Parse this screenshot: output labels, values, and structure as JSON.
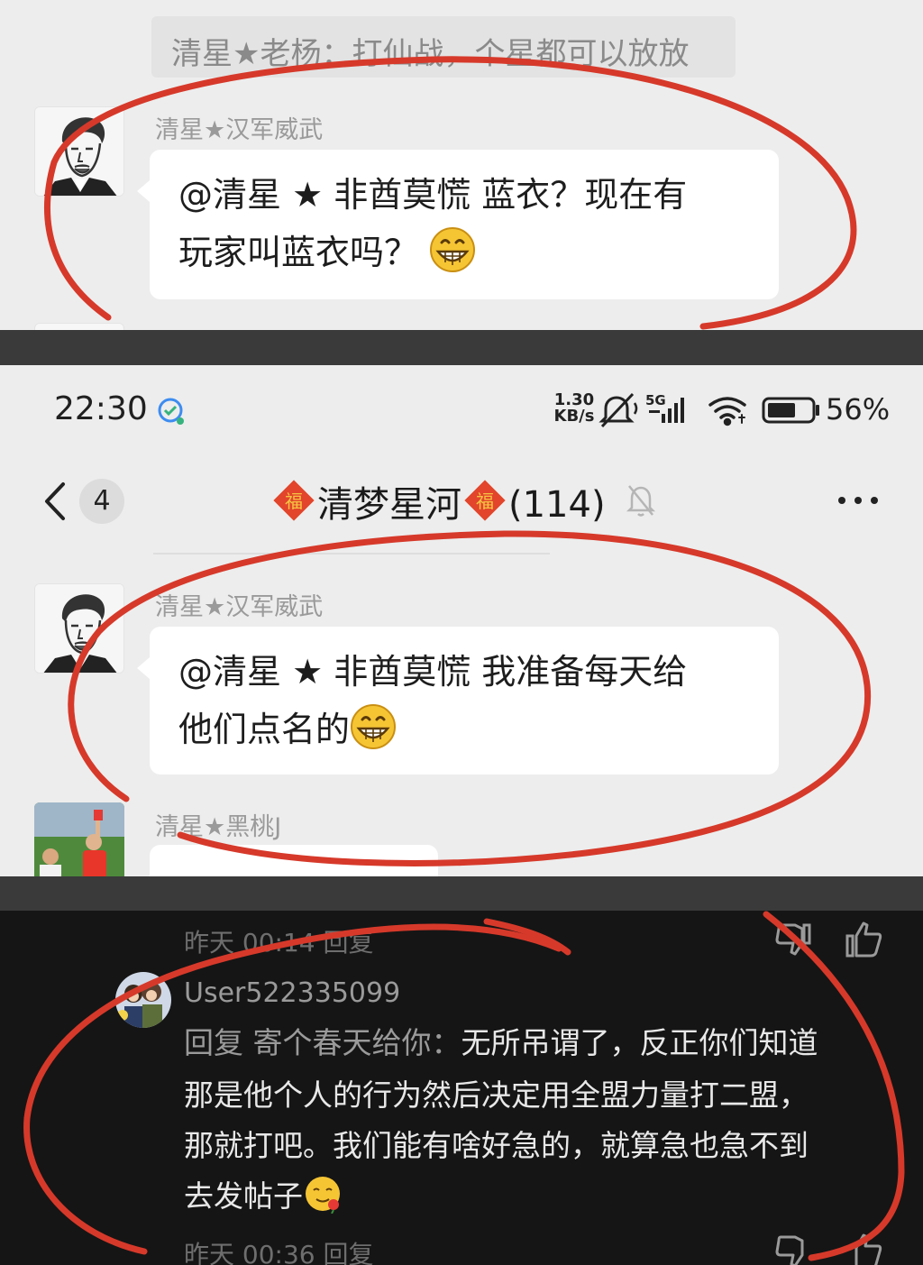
{
  "panel1": {
    "previous_message": "清星★老杨：打仙战，个星都可以放放",
    "message": {
      "sender": "清星★汉军威武",
      "line1": "@清星 ★ 非酋莫慌  蓝衣？现在有",
      "line2": "玩家叫蓝衣吗？"
    }
  },
  "panel2": {
    "status_bar": {
      "time": "22:30",
      "net_speed_value": "1.30",
      "net_speed_unit": "KB/s",
      "network": "5G",
      "battery": "56%"
    },
    "header": {
      "back_count": "4",
      "group_name": "清梦星河",
      "member_count": "(114)"
    },
    "messages": [
      {
        "sender": "清星★汉军威武",
        "line1": "@清星 ★ 非酋莫慌  我准备每天给",
        "line2": "他们点名的"
      },
      {
        "sender": "清星★黑桃J"
      }
    ]
  },
  "panel3": {
    "top_meta": "昨天 00:14  回复",
    "comment": {
      "username": "User522335099",
      "reply_prefix": "回复 寄个春天给你：",
      "line1_rest": "无所吊谓了，反正你们知道",
      "line2": "那是他个人的行为然后决定用全盟力量打二盟，",
      "line3": "那就打吧。我们能有啥好急的，就算急也急不到",
      "line4": "去发帖子"
    },
    "bottom_meta": "昨天 00:36  回复"
  },
  "colors": {
    "chat_background": "#ededed",
    "bubble": "#ffffff",
    "dark_background": "#151515",
    "annotation_red": "#d6392a"
  }
}
